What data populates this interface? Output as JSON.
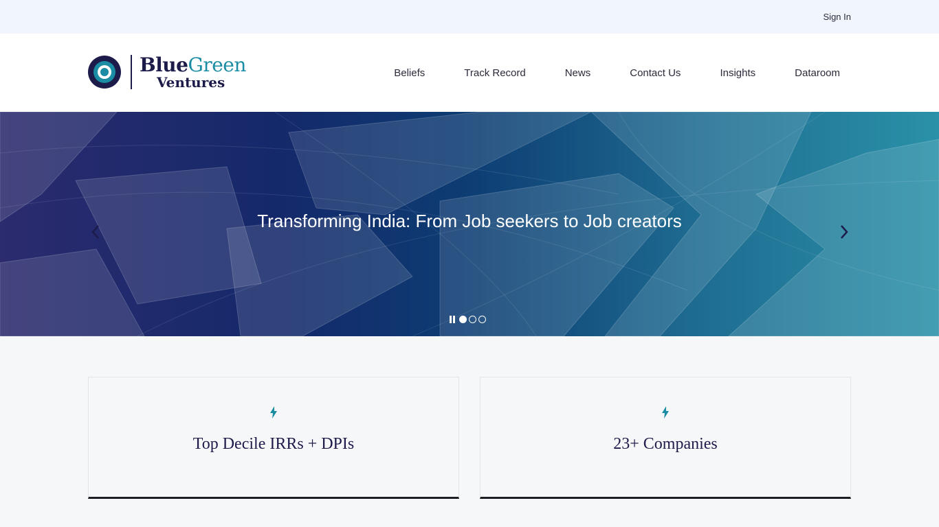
{
  "topbar": {
    "signin_label": "Sign In"
  },
  "logo": {
    "word_blue": "Blue",
    "word_green": "Green",
    "word_ventures": "Ventures"
  },
  "nav": {
    "items": [
      {
        "label": "Beliefs"
      },
      {
        "label": "Track Record"
      },
      {
        "label": "News"
      },
      {
        "label": "Contact Us"
      },
      {
        "label": "Insights"
      },
      {
        "label": "Dataroom"
      }
    ]
  },
  "hero": {
    "title": "Transforming India: From Job seekers to Job creators",
    "prev_icon": "chevron-left-icon",
    "next_icon": "chevron-right-icon",
    "slides_total": 3,
    "active_slide": 1
  },
  "cards": [
    {
      "icon": "bolt-icon",
      "title": "Top Decile IRRs + DPIs"
    },
    {
      "icon": "bolt-icon",
      "title": "23+ Companies"
    }
  ],
  "colors": {
    "brand_navy": "#1c1b4a",
    "brand_teal": "#1a8ca3",
    "topbar_bg": "#f0f6fc",
    "card_border_bottom": "#1d1d24"
  }
}
